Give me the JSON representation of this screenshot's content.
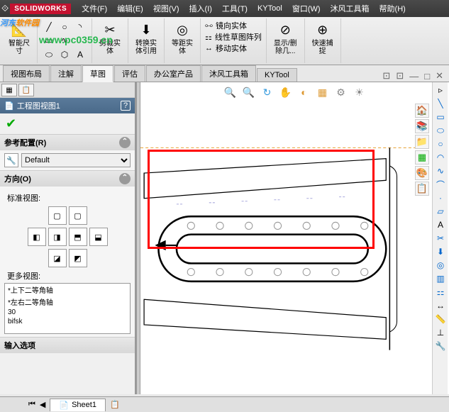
{
  "app": {
    "title": "SOLIDWORKS"
  },
  "menu": {
    "file": "文件(F)",
    "edit": "编辑(E)",
    "view": "视图(V)",
    "insert": "插入(I)",
    "tools": "工具(T)",
    "kytool": "KYTool",
    "window": "窗口(W)",
    "mufeng": "沐风工具箱",
    "help": "帮助(H)"
  },
  "watermark": {
    "text1": "河东",
    "text2": "软件园",
    "url": "www.pc0359.cn"
  },
  "ribbon": {
    "smart_dim": "智能尺\n寸",
    "trim": "剪裁实\n体",
    "convert": "转换实\n体引用",
    "offset": "等距实\n体",
    "mirror": "镜向实体",
    "linear_pattern": "线性草图阵列",
    "move": "移动实体",
    "show_del": "显示/删\n除几...",
    "quick_snap": "快速捕\n捉"
  },
  "tabs": {
    "layout": "视图布局",
    "annotation": "注解",
    "sketch": "草图",
    "evaluate": "评估",
    "office": "办公室产品",
    "mufeng": "沐风工具箱",
    "kytool": "KYTool"
  },
  "panel": {
    "title": "工程图视图1",
    "ref_config": "参考配置(R)",
    "config_default": "Default",
    "orientation": "方向(O)",
    "std_views": "标准视图:",
    "more_views": "更多视图:",
    "view_items": [
      "*上下二等角轴",
      "*左右二等角轴",
      "30",
      "bifsk"
    ],
    "input_options": "输入选项"
  },
  "sheet": {
    "name": "Sheet1"
  }
}
